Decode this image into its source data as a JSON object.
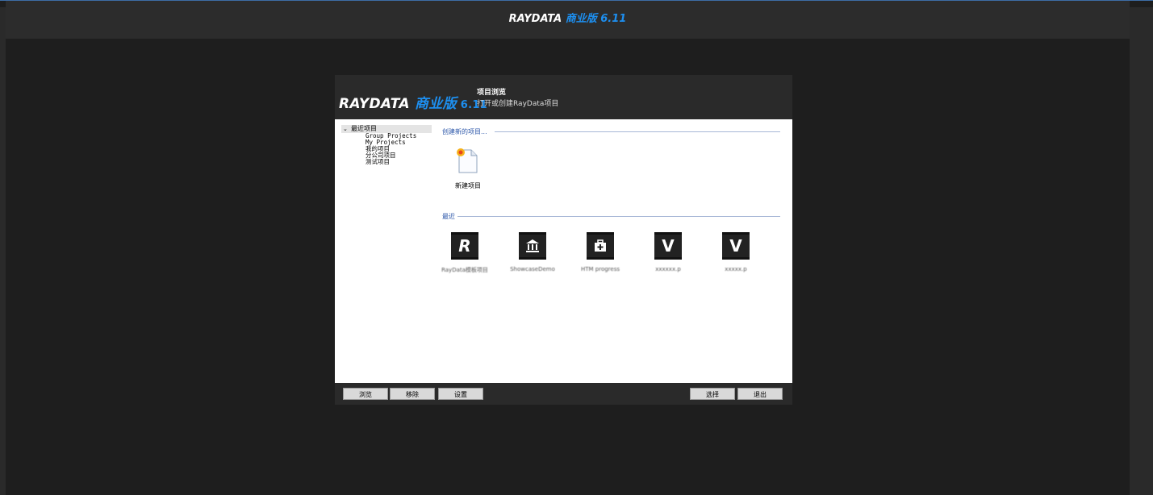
{
  "app": {
    "title_brand": "RAYDATA ",
    "title_cn": "商业版",
    "title_version": " 6.11"
  },
  "dialog": {
    "logo": {
      "brand": "RAYDATA ",
      "cn": "商业版",
      "version": " 6.11"
    },
    "header_title": "项目浏览",
    "header_subtitle": "打开或创建RayData项目",
    "tree": {
      "root": "最近项目",
      "items": [
        "Group Projects",
        "My Projects",
        "我的项目",
        "分公司项目",
        "测试项目"
      ]
    },
    "create_section": "创建新的项目...",
    "new_project_label": "新建项目",
    "recent_section": "最近",
    "recent_items": [
      {
        "label": "RayData模板项目",
        "icon": "R"
      },
      {
        "label": "ShowcaseDemo",
        "icon": "bank-icon"
      },
      {
        "label": "HTM progress",
        "icon": "medkit-icon"
      },
      {
        "label": "xxxxxx.p",
        "icon": "V"
      },
      {
        "label": "xxxxx.p",
        "icon": "V"
      }
    ],
    "buttons": {
      "browse": "浏览",
      "remove": "移除",
      "settings": "设置",
      "select": "选择",
      "exit": "退出"
    }
  }
}
